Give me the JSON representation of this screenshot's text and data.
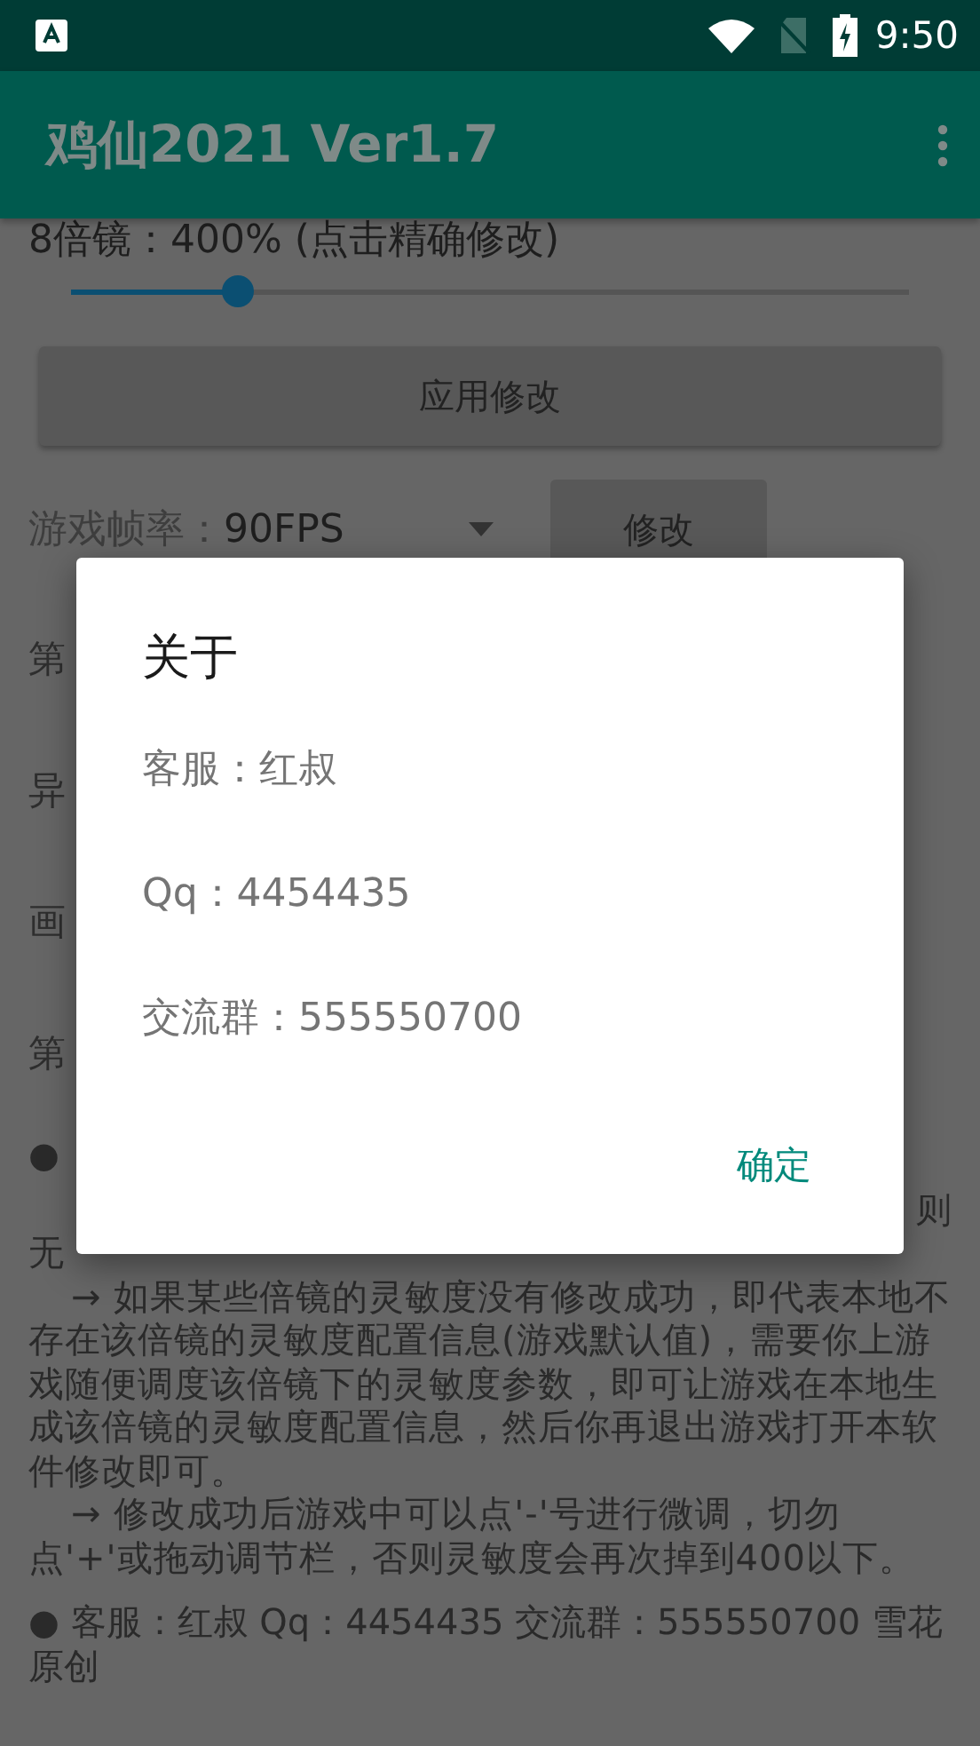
{
  "status_bar": {
    "time": "9:50"
  },
  "app_bar": {
    "title": "鸡仙2021 Ver1.7"
  },
  "scope": {
    "label": "8倍镜：400%  (点击精确修改)",
    "level": 0.2
  },
  "apply_button": "应用修改",
  "frame_rate": {
    "label": "游戏帧率：",
    "value": "90FPS",
    "button": "修改"
  },
  "covered_rows": [
    "第",
    "异",
    "画",
    "第"
  ],
  "covered_bullet": "●",
  "covered_line_end": "则",
  "covered_line_start": "无",
  "notes": [
    "→ 如果某些倍镜的灵敏度没有修改成功，即代表本地不存在该倍镜的灵敏度配置信息(游戏默认值)，需要你上游戏随便调度该倍镜下的灵敏度参数，即可让游戏在本地生成该倍镜的灵敏度配置信息，然后你再退出游戏打开本软件修改即可。",
    "→ 修改成功后游戏中可以点'-'号进行微调，切勿点'+'或拖动调节栏，否则灵敏度会再次掉到400以下。"
  ],
  "footer": "● 客服：红叔  Qq：4454435  交流群：555550700 雪花原创",
  "dialog": {
    "title": "关于",
    "lines": [
      "客服：红叔",
      "Qq：4454435",
      "交流群：555550700"
    ],
    "button": "确定"
  }
}
